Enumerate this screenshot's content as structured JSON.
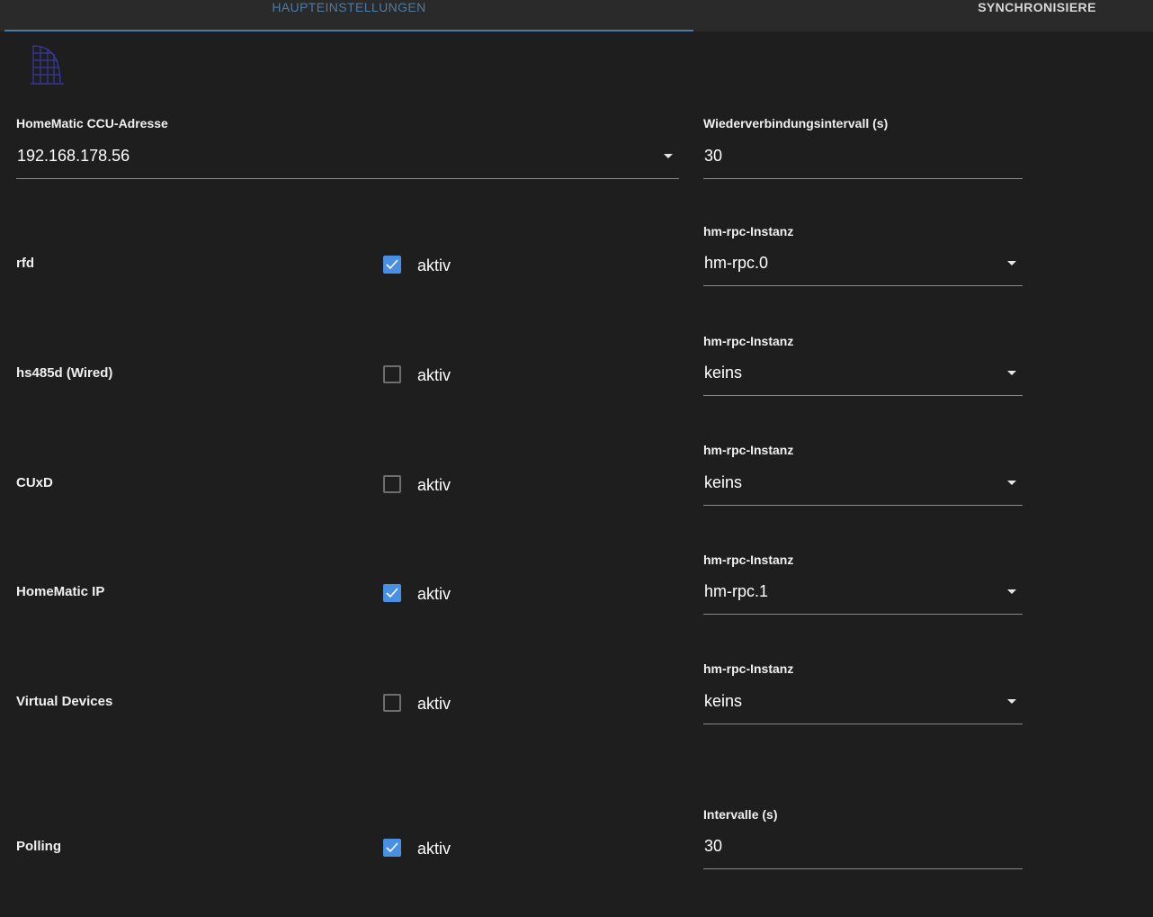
{
  "tabs": {
    "main": "Haupteinstellungen",
    "sync": "Synchronisiere"
  },
  "ccu": {
    "label": "HomeMatic CCU-Adresse",
    "value": "192.168.178.56"
  },
  "reconnect": {
    "label": "Wiederverbindungsintervall (s)",
    "value": "30"
  },
  "rows": [
    {
      "name": "rfd",
      "checked": true,
      "check_label": "aktiv",
      "select_label": "hm-rpc-Instanz",
      "select_value": "hm-rpc.0"
    },
    {
      "name": "hs485d (Wired)",
      "checked": false,
      "check_label": "aktiv",
      "select_label": "hm-rpc-Instanz",
      "select_value": "keins"
    },
    {
      "name": "CUxD",
      "checked": false,
      "check_label": "aktiv",
      "select_label": "hm-rpc-Instanz",
      "select_value": "keins"
    },
    {
      "name": "HomeMatic IP",
      "checked": true,
      "check_label": "aktiv",
      "select_label": "hm-rpc-Instanz",
      "select_value": "hm-rpc.1"
    },
    {
      "name": "Virtual Devices",
      "checked": false,
      "check_label": "aktiv",
      "select_label": "hm-rpc-Instanz",
      "select_value": "keins"
    }
  ],
  "polling": {
    "name": "Polling",
    "checked": true,
    "check_label": "aktiv",
    "interval_label": "Intervalle (s)",
    "interval_value": "30"
  },
  "colors": {
    "background": "#1e1e1e",
    "tab_active": "#4e7ba3",
    "checkbox_on": "#4a90e2"
  }
}
